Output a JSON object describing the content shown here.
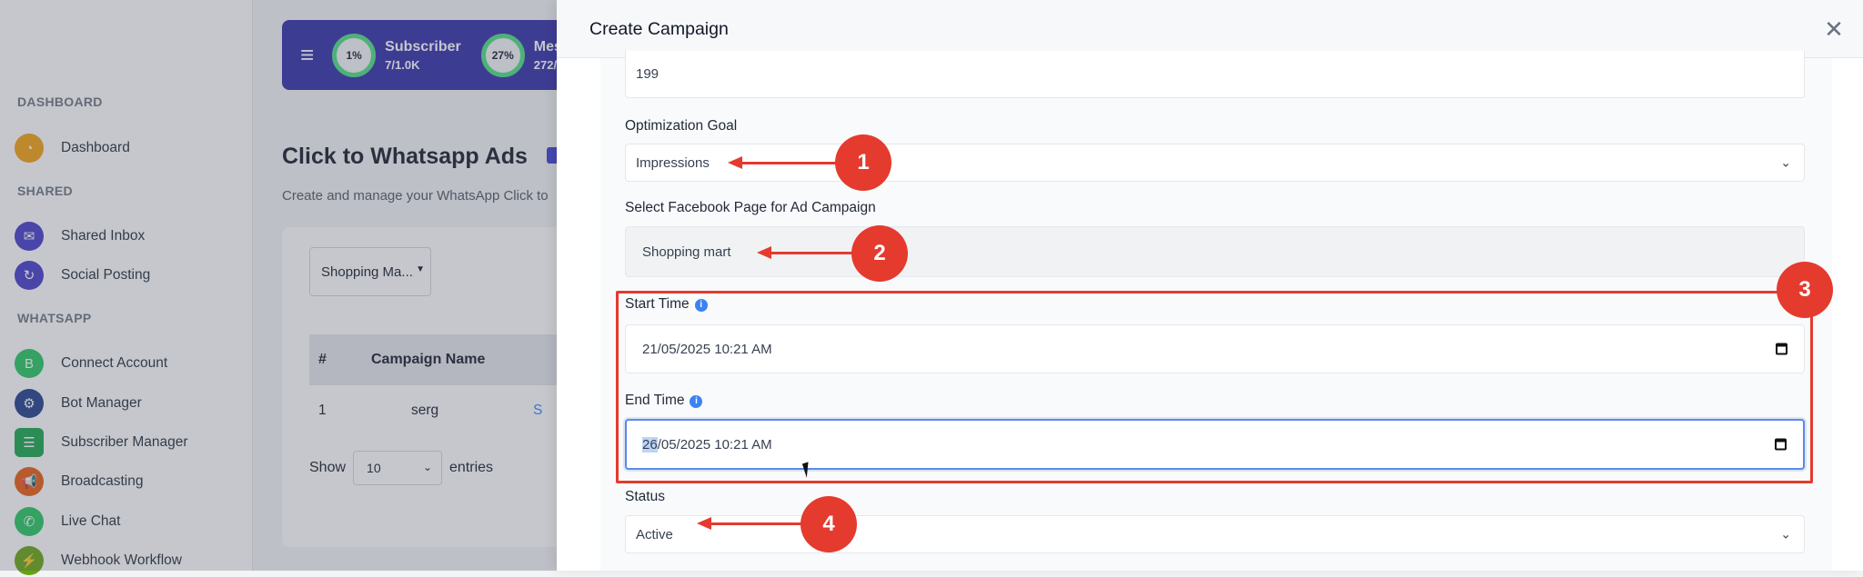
{
  "sidebar": {
    "sections": {
      "dashboard": "DASHBOARD",
      "shared": "SHARED",
      "whatsapp": "WHATSAPP"
    },
    "items": [
      {
        "label": "Dashboard",
        "icon": "speedometer-icon"
      },
      {
        "label": "Shared Inbox",
        "icon": "inbox-icon"
      },
      {
        "label": "Social Posting",
        "icon": "social-posting-icon"
      },
      {
        "label": "Connect Account",
        "icon": "whatsapp-connect-icon"
      },
      {
        "label": "Bot Manager",
        "icon": "bot-icon"
      },
      {
        "label": "Subscriber Manager",
        "icon": "subscriber-icon"
      },
      {
        "label": "Broadcasting",
        "icon": "megaphone-icon"
      },
      {
        "label": "Live Chat",
        "icon": "chat-icon"
      },
      {
        "label": "Webhook Workflow",
        "icon": "webhook-icon"
      }
    ]
  },
  "topbar": {
    "stats": [
      {
        "percent": "1%",
        "title": "Subscriber",
        "sub": "7/1.0K"
      },
      {
        "percent": "27%",
        "title": "Mes",
        "sub": "272/"
      }
    ]
  },
  "page": {
    "title": "Click to Whatsapp Ads",
    "description": "Create and manage your WhatsApp Click to"
  },
  "card": {
    "filter_value": "Shopping Ma...",
    "table_headers": [
      "#",
      "Campaign Name"
    ],
    "rows": [
      {
        "num": "1",
        "name": "serg",
        "extra": "S"
      }
    ],
    "show_label": "Show",
    "show_value": "10",
    "entries_label": "entries"
  },
  "modal": {
    "title": "Create Campaign",
    "budget_value": "199",
    "optimization_goal_label": "Optimization Goal",
    "optimization_goal_value": "Impressions",
    "facebook_page_label": "Select Facebook Page for Ad Campaign",
    "facebook_page_value": "Shopping mart",
    "start_time_label": "Start Time",
    "start_time_value": "21/05/2025 10:21 AM",
    "end_time_label": "End Time",
    "end_time_selected": "26",
    "end_time_rest": "/05/2025 10:21 AM",
    "status_label": "Status",
    "status_value": "Active"
  },
  "annotations": {
    "markers": [
      "1",
      "2",
      "3",
      "4"
    ],
    "color": "#e53a2e"
  },
  "colors": {
    "topbar": "#2f2aa8",
    "accent_green": "#4ade80",
    "focus_border": "#5b8ae6"
  }
}
